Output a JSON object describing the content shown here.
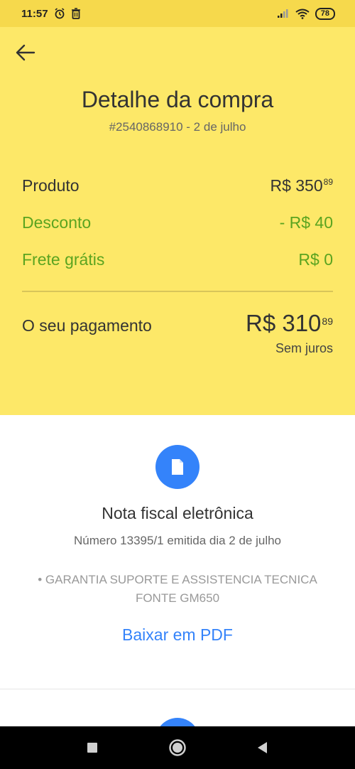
{
  "status_bar": {
    "time": "11:57",
    "icons": [
      "alarm-icon",
      "trash-icon",
      "signal-icon",
      "wifi-icon"
    ],
    "battery": "78"
  },
  "header": {
    "back_icon": "arrow-left-icon",
    "title": "Detalhe da compra",
    "subtitle": "#2540868910 - 2 de julho"
  },
  "summary": {
    "produto": {
      "label": "Produto",
      "amount": "R$ 350",
      "cents": "89"
    },
    "desconto": {
      "label": "Desconto",
      "amount": "- R$ 40"
    },
    "frete": {
      "label": "Frete grátis",
      "amount": "R$ 0"
    },
    "pagamento": {
      "label": "O seu pagamento",
      "amount": "R$ 310",
      "cents": "89",
      "note": "Sem juros"
    }
  },
  "colors": {
    "header_bg": "#fde868",
    "status_bg": "#f6d94c",
    "green": "#5ba420",
    "blue": "#3483fa"
  },
  "invoice": {
    "icon": "document-icon",
    "title": "Nota fiscal eletrônica",
    "number": "Número 13395/1 emitida dia 2 de julho",
    "description": "• GARANTIA SUPORTE E ASSISTENCIA TECNICA FONTE GM650",
    "download_label": "Baixar em PDF"
  },
  "nav_bar": {
    "icons": [
      "recents-square-icon",
      "home-circle-icon",
      "back-triangle-icon"
    ]
  }
}
